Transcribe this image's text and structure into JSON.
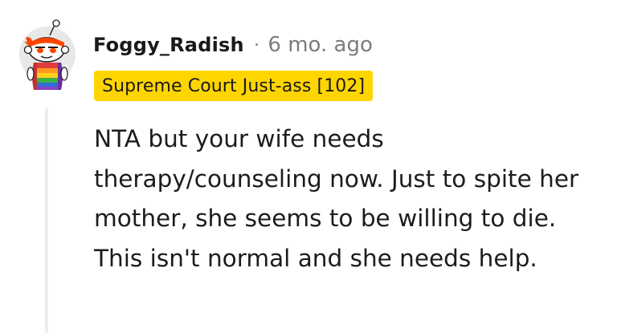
{
  "comment": {
    "author": "Foggy_Radish",
    "separator": "·",
    "age": "6 mo. ago",
    "flair": "Supreme Court Just-ass [102]",
    "body": "NTA but your wife needs therapy/counseling now. Just to spite her mother, she seems to be willing to die. This isn't normal and she needs help."
  },
  "colors": {
    "flair_background": "#ffd500",
    "username": "#1a1a1b",
    "timestamp": "#7c7c7c",
    "thread_line": "#ededed",
    "avatar_background": "#e8e8e8",
    "avatar_headband": "#ff4500"
  },
  "icons": {
    "avatar": "snoo-avatar-icon"
  }
}
